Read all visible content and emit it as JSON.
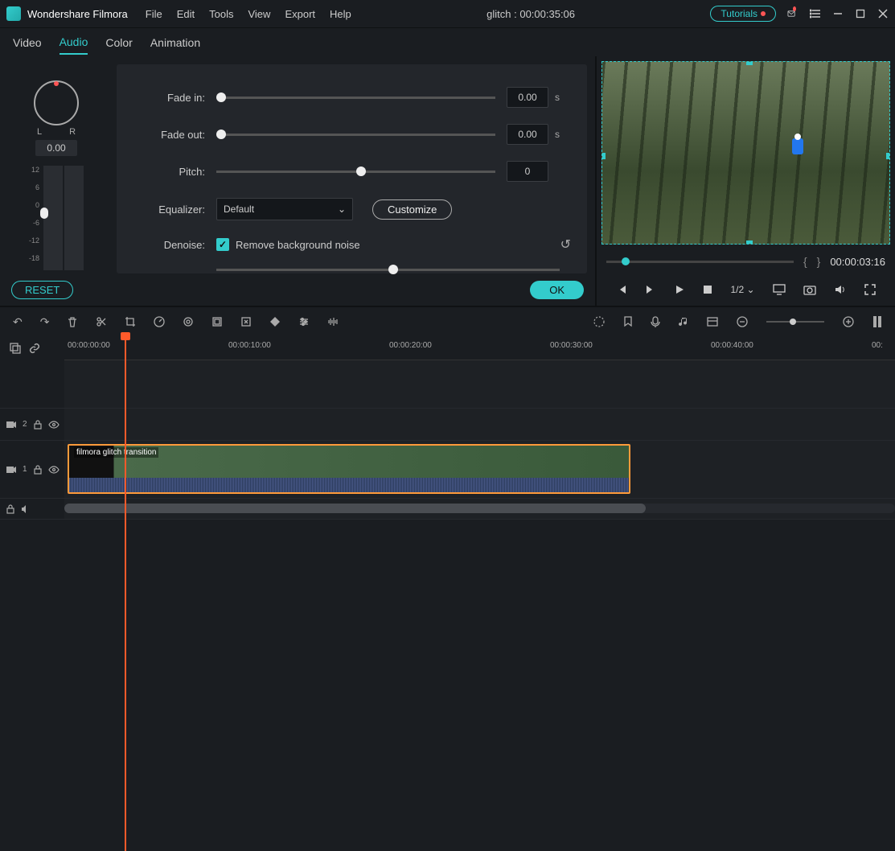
{
  "title_bar": {
    "app_name": "Wondershare Filmora",
    "menus": [
      "File",
      "Edit",
      "Tools",
      "View",
      "Export",
      "Help"
    ],
    "project_label": "glitch : 00:00:35:06",
    "tutorials_label": "Tutorials"
  },
  "tabs": {
    "items": [
      "Video",
      "Audio",
      "Color",
      "Animation"
    ],
    "active": "Audio"
  },
  "audio_panel": {
    "pan": {
      "L": "L",
      "R": "R",
      "value": "0.00"
    },
    "vu_ticks": [
      "12",
      "6",
      "0",
      "-6",
      "-12",
      "-18"
    ],
    "fade_in": {
      "label": "Fade in:",
      "value": "0.00",
      "unit": "s"
    },
    "fade_out": {
      "label": "Fade out:",
      "value": "0.00",
      "unit": "s"
    },
    "pitch": {
      "label": "Pitch:",
      "value": "0"
    },
    "equalizer": {
      "label": "Equalizer:",
      "selected": "Default",
      "customize": "Customize"
    },
    "denoise": {
      "label": "Denoise:",
      "checkbox_label": "Remove background noise"
    },
    "reset": "RESET",
    "ok": "OK"
  },
  "preview": {
    "timecode": "00:00:03:16",
    "speed": "1/2"
  },
  "ruler": {
    "marks": [
      "00:00:00:00",
      "00:00:10:00",
      "00:00:20:00",
      "00:00:30:00",
      "00:00:40:00",
      "00:"
    ]
  },
  "tracks": {
    "t2_label": "2",
    "t1_label": "1",
    "clip_name": "filmora glitch transition"
  }
}
